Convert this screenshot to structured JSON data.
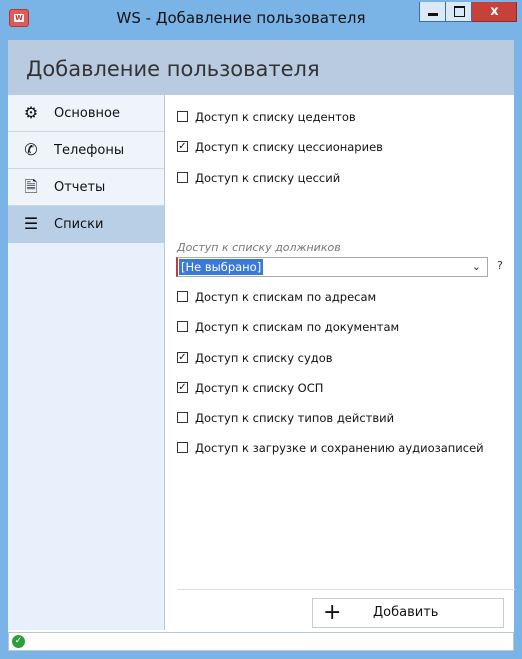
{
  "window": {
    "title": "WS - Добавление пользователя",
    "icon": "app-icon",
    "buttons": {
      "minimize": "_",
      "maximize": "□",
      "close": "x"
    }
  },
  "header": {
    "title": "Добавление пользователя"
  },
  "sidebar": {
    "items": [
      {
        "label": "Основное",
        "icon": "gear-icon",
        "glyph": "⚙",
        "active": false
      },
      {
        "label": "Телефоны",
        "icon": "phone-icon",
        "glyph": "✆",
        "active": false
      },
      {
        "label": "Отчеты",
        "icon": "report-icon",
        "glyph": "🗎",
        "active": false
      },
      {
        "label": "Списки",
        "icon": "list-icon",
        "glyph": "☰",
        "active": true
      }
    ]
  },
  "permissions": {
    "cedents": {
      "label": "Доступ к списку цедентов",
      "checked": false
    },
    "cessionaries": {
      "label": "Доступ к списку цессионариев",
      "checked": true
    },
    "cessions": {
      "label": "Доступ к списку цессий",
      "checked": false
    },
    "debtors_field": {
      "label": "Доступ к списку должников",
      "value": "[Не выбрано]",
      "help": "?"
    },
    "addresses": {
      "label": "Доступ к спискам по адресам",
      "checked": false
    },
    "documents": {
      "label": "Доступ к спискам по документам",
      "checked": false
    },
    "courts": {
      "label": "Доступ к списку судов",
      "checked": true
    },
    "osp": {
      "label": "Доступ к списку ОСП",
      "checked": true
    },
    "action_types": {
      "label": "Доступ к списку типов действий",
      "checked": false
    },
    "audio": {
      "label": "Доступ к загрузке и сохранению аудиозаписей",
      "checked": false
    }
  },
  "actions": {
    "add_label": "Добавить",
    "add_icon": "+"
  },
  "status": {
    "icon": "check-circle-icon",
    "state": "ok"
  },
  "colors": {
    "accent": "#7ab4e6",
    "header": "#b9cbe0",
    "sidebar": "#e8f1fb",
    "active_item": "#b9cfe6",
    "select_highlight": "#3b79d6",
    "required_marker": "#c43a3a",
    "status_ok": "#2f9e3a"
  }
}
